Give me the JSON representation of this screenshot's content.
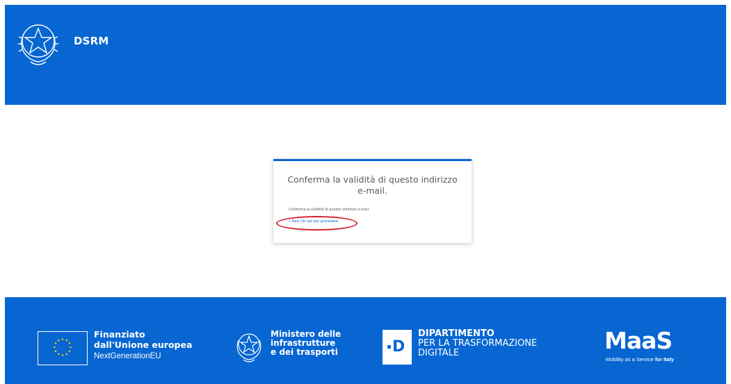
{
  "header": {
    "app_title": "DSRM",
    "emblem_icon": "italian-republic-emblem-icon"
  },
  "card": {
    "heading_line1": "Conferma la validità di questo indirizzo",
    "heading_line2": "e-mail.",
    "body_text": "Conferma la validità di questo indirizzo e-mail.",
    "link_text": "» Fare clic qui per procedere",
    "accent_color": "#0766d1",
    "highlight_color": "#d2202b"
  },
  "footer": {
    "eu": {
      "icon": "eu-flag-icon",
      "line1": "Finanziato",
      "line2": "dall'Unione europea",
      "line3": "NextGenerationEU"
    },
    "ministry": {
      "icon": "italian-republic-emblem-icon",
      "line1": "Ministero delle",
      "line2": "infrastrutture",
      "line3": "e dei trasporti"
    },
    "department": {
      "logo_letter": "D",
      "line1": "DIPARTIMENTO",
      "line2": "PER LA TRASFORMAZIONE",
      "line3": "DIGITALE"
    },
    "maas": {
      "brand": "MaaS",
      "subtitle_prefix": "Mobility as a Service",
      "subtitle_bold": "for Italy"
    }
  },
  "colors": {
    "brand_blue": "#0766d1",
    "white": "#ffffff"
  }
}
